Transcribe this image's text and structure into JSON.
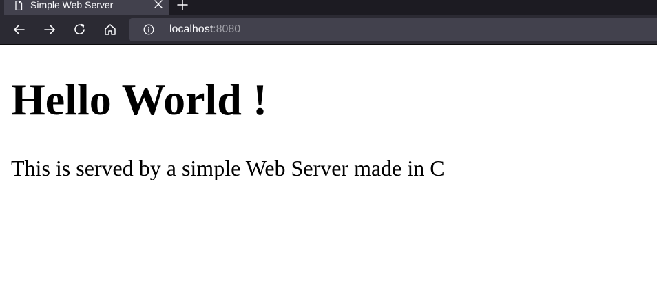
{
  "browser": {
    "tab": {
      "title": "Simple Web Server"
    },
    "urlbar": {
      "host": "localhost",
      "port": ":8080"
    }
  },
  "page": {
    "heading": "Hello World !",
    "paragraph": "This is served by a simple Web Server made in C"
  },
  "colors": {
    "tab_strip_bg": "#1c1b22",
    "toolbar_bg": "#2b2a33",
    "active_tab_bg": "#42414d",
    "urlbar_bg": "#42414d",
    "chrome_text": "#fbfbfe",
    "port_text": "#9e9ea6",
    "page_bg": "#ffffff",
    "page_text": "#000000"
  },
  "icons": {
    "tab_icon": "document-icon",
    "tab_close": "close-icon",
    "new_tab": "plus-icon",
    "back": "back-arrow-icon",
    "forward": "forward-arrow-icon",
    "reload": "reload-icon",
    "home": "home-icon",
    "site_info": "info-icon"
  }
}
